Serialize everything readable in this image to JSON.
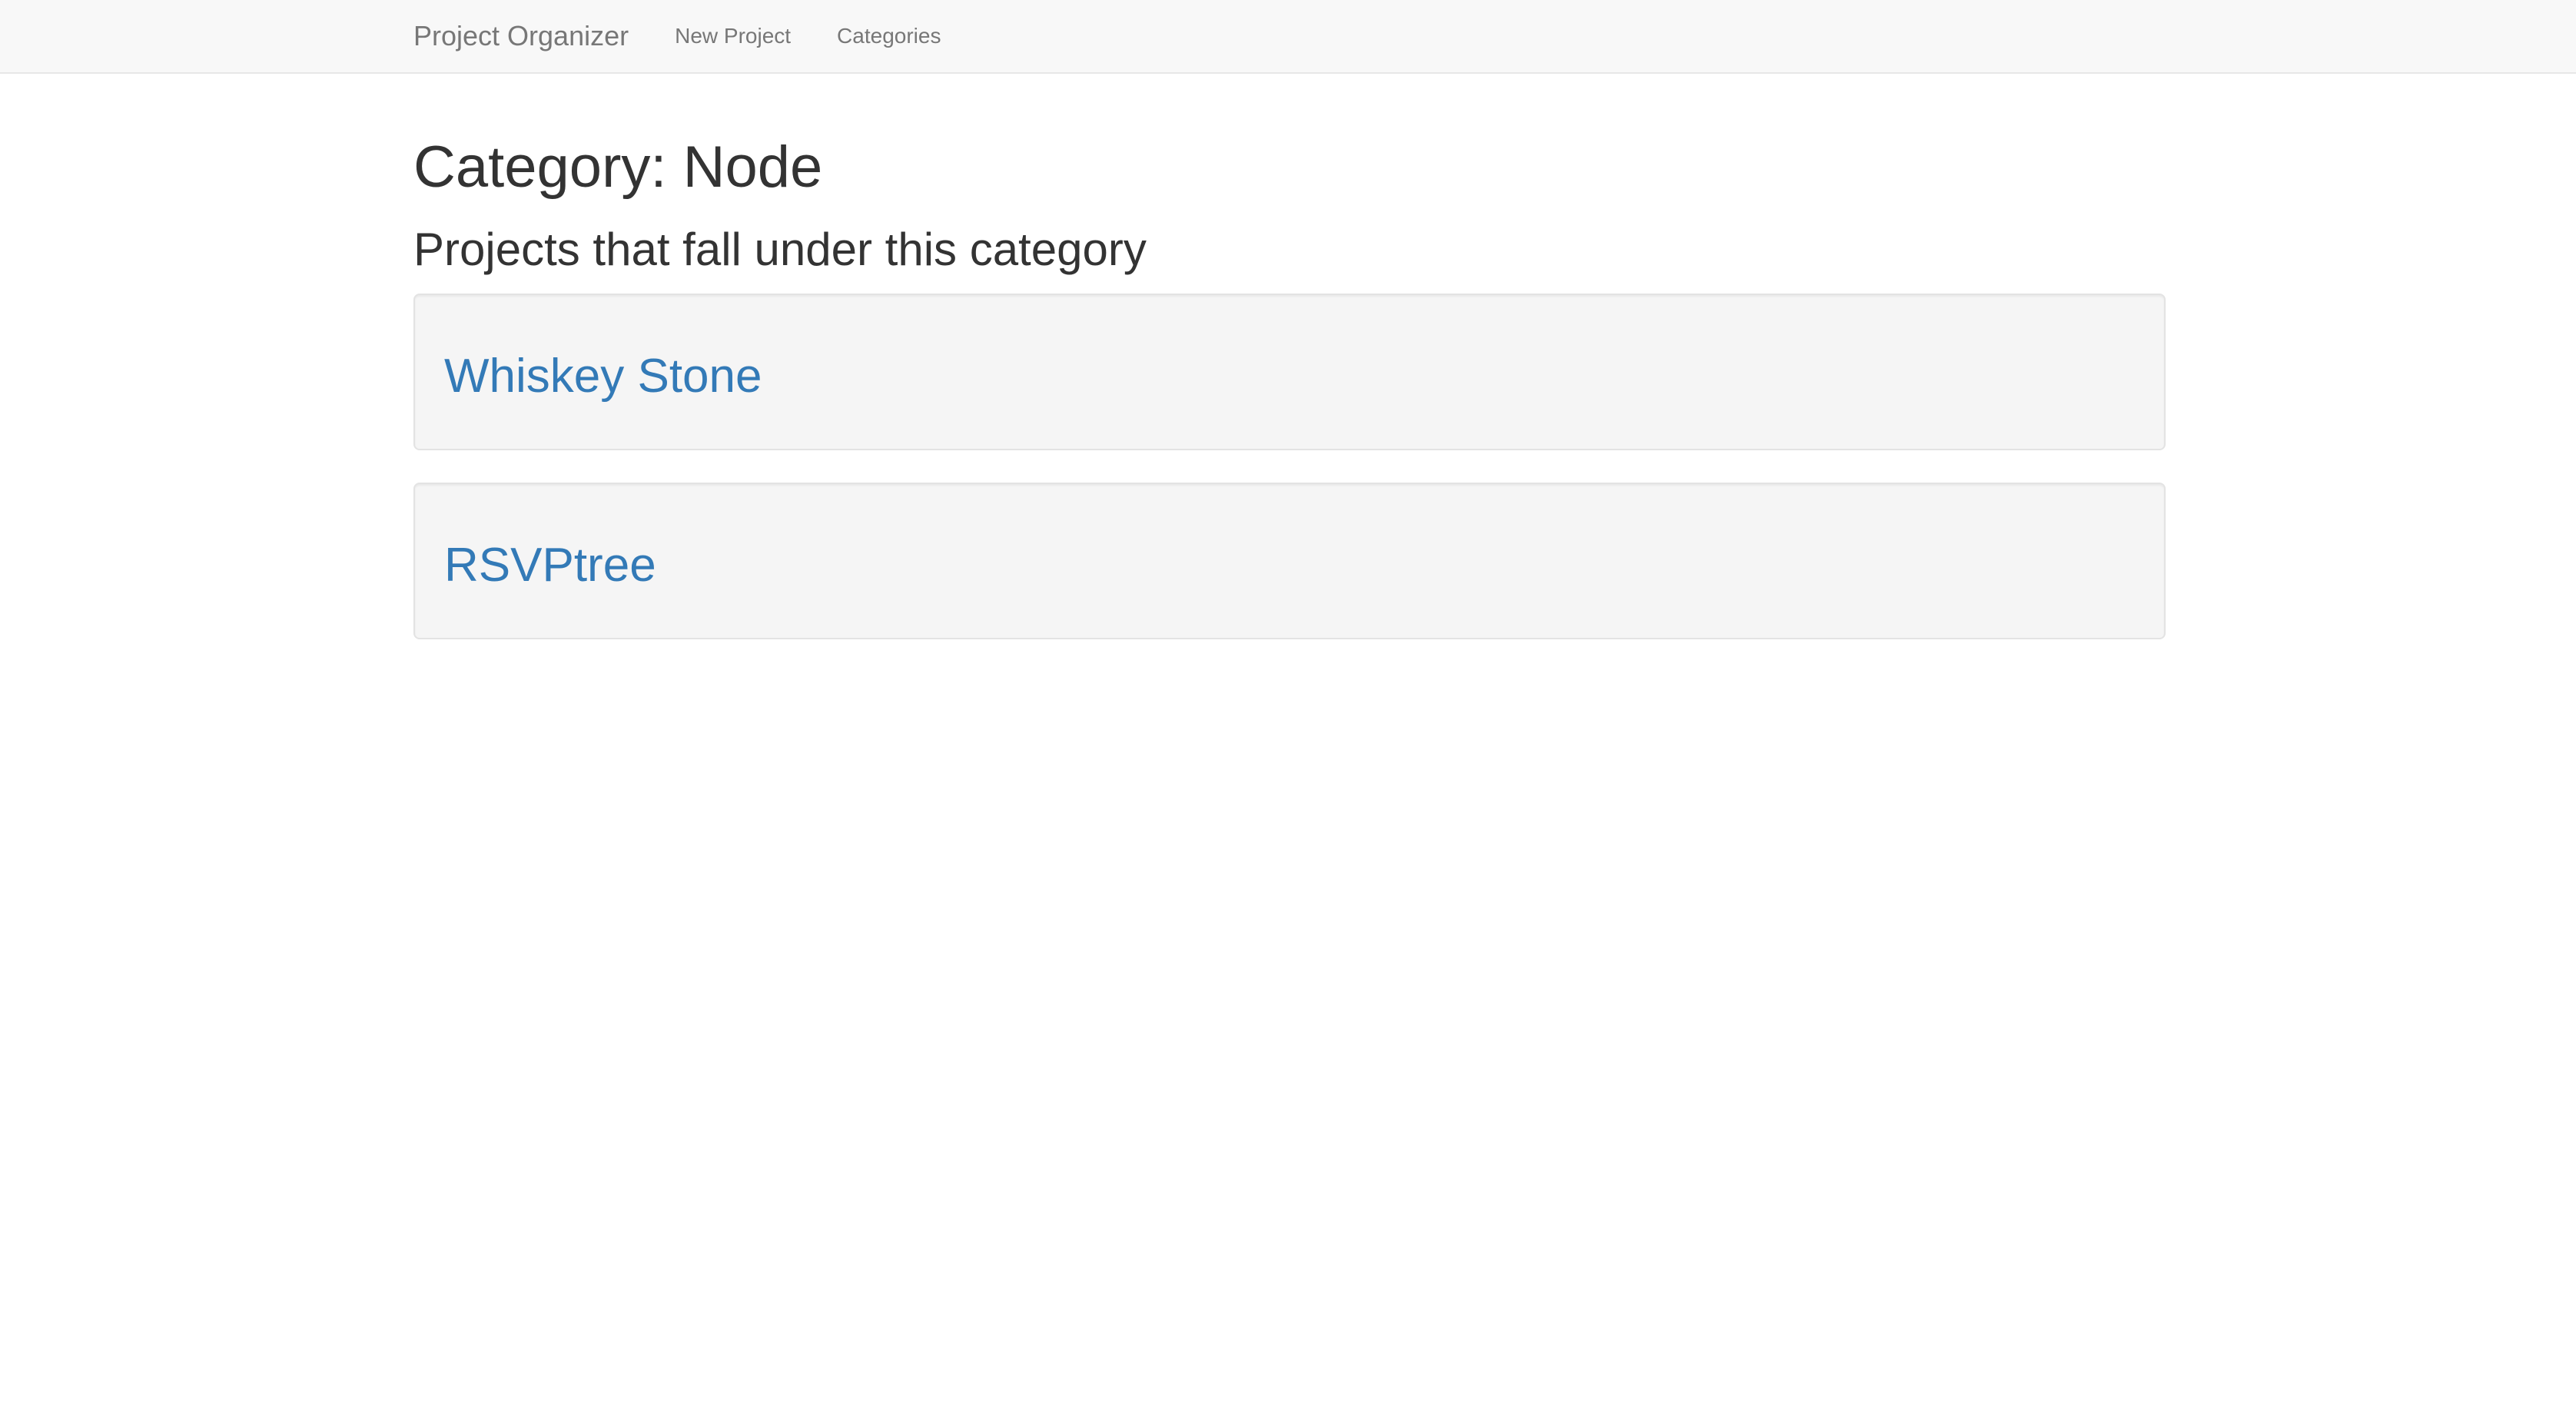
{
  "navbar": {
    "brand": "Project Organizer",
    "links": [
      {
        "label": "New Project"
      },
      {
        "label": "Categories"
      }
    ]
  },
  "page": {
    "title": "Category: Node",
    "subtitle": "Projects that fall under this category"
  },
  "projects": [
    {
      "name": "Whiskey Stone"
    },
    {
      "name": "RSVPtree"
    }
  ],
  "colors": {
    "link": "#337ab7",
    "navbar_bg": "#f8f8f8",
    "well_bg": "#f5f5f5",
    "text": "#333333"
  }
}
